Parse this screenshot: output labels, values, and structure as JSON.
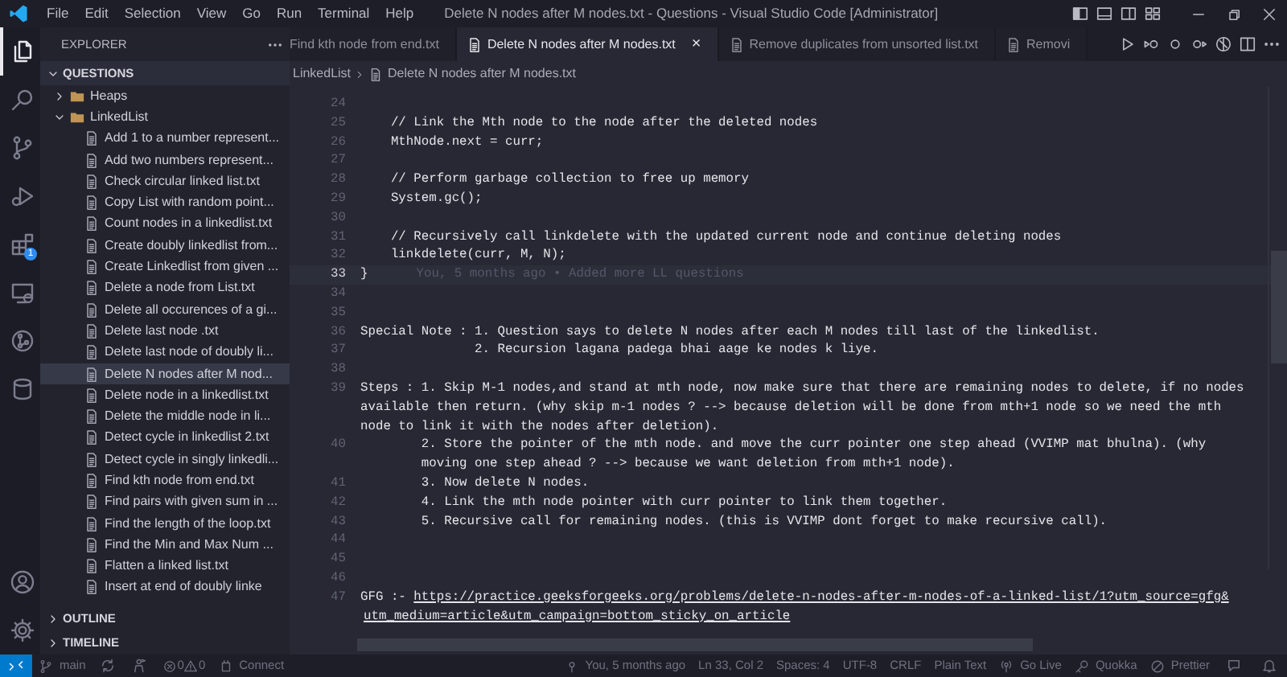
{
  "title_bar": {
    "menu": [
      "File",
      "Edit",
      "Selection",
      "View",
      "Go",
      "Run",
      "Terminal",
      "Help"
    ],
    "title": "Delete N nodes after M nodes.txt - Questions - Visual Studio Code [Administrator]"
  },
  "activity_bar": {
    "top": [
      {
        "kind": "explorer",
        "selected": true
      },
      {
        "kind": "search",
        "selected": false
      },
      {
        "kind": "scm",
        "selected": false
      },
      {
        "kind": "debug",
        "selected": false
      },
      {
        "kind": "extensions",
        "selected": false,
        "badge": "1"
      },
      {
        "kind": "remote",
        "selected": false
      },
      {
        "kind": "graph",
        "selected": false
      },
      {
        "kind": "database",
        "selected": false
      }
    ],
    "bottom": [
      {
        "kind": "account",
        "selected": false
      },
      {
        "kind": "settings",
        "selected": false
      }
    ]
  },
  "sidebar": {
    "title": "EXPLORER",
    "sections": [
      {
        "label": "QUESTIONS",
        "expanded": true,
        "tree": [
          {
            "label": "Heaps",
            "kind": "folder",
            "expanded": false,
            "selected": false
          },
          {
            "label": "LinkedList",
            "kind": "folder",
            "expanded": true,
            "selected": false,
            "children": [
              {
                "label": "Add 1 to a number represent...",
                "kind": "file",
                "selected": false
              },
              {
                "label": "Add two numbers represent...",
                "kind": "file",
                "selected": false
              },
              {
                "label": "Check circular linked list.txt",
                "kind": "file",
                "selected": false
              },
              {
                "label": "Copy List with random point...",
                "kind": "file",
                "selected": false
              },
              {
                "label": "Count nodes in a linkedlist.txt",
                "kind": "file",
                "selected": false
              },
              {
                "label": "Create doubly linkedlist from...",
                "kind": "file",
                "selected": false
              },
              {
                "label": "Create Linkedlist from given ...",
                "kind": "file",
                "selected": false
              },
              {
                "label": "Delete a node from List.txt",
                "kind": "file",
                "selected": false
              },
              {
                "label": "Delete all occurences of a gi...",
                "kind": "file",
                "selected": false
              },
              {
                "label": "Delete last node .txt",
                "kind": "file",
                "selected": false
              },
              {
                "label": "Delete last node of doubly li...",
                "kind": "file",
                "selected": false
              },
              {
                "label": "Delete N nodes after M nod...",
                "kind": "file",
                "selected": true
              },
              {
                "label": "Delete node in a linkedlist.txt",
                "kind": "file",
                "selected": false
              },
              {
                "label": "Delete the middle node in li...",
                "kind": "file",
                "selected": false
              },
              {
                "label": "Detect cycle in linkedlist 2.txt",
                "kind": "file",
                "selected": false
              },
              {
                "label": "Detect cycle in singly linkedli...",
                "kind": "file",
                "selected": false
              },
              {
                "label": "Find kth node from end.txt",
                "kind": "file",
                "selected": false
              },
              {
                "label": "Find pairs with given sum in ...",
                "kind": "file",
                "selected": false
              },
              {
                "label": "Find the length of the loop.txt",
                "kind": "file",
                "selected": false
              },
              {
                "label": "Find the Min and Max Num ...",
                "kind": "file",
                "selected": false
              },
              {
                "label": "Flatten a linked list.txt",
                "kind": "file",
                "selected": false
              },
              {
                "label": "Insert at end of doubly linke",
                "kind": "file",
                "selected": false
              }
            ]
          }
        ]
      },
      {
        "label": "OUTLINE",
        "expanded": false
      },
      {
        "label": "TIMELINE",
        "expanded": false
      }
    ]
  },
  "tabs": [
    {
      "label": "Find kth node from end.txt",
      "selected": false,
      "show_icon": false
    },
    {
      "label": "Delete N nodes after M nodes.txt",
      "selected": true,
      "show_icon": true,
      "close": "×"
    },
    {
      "label": "Remove duplicates from unsorted list.txt",
      "selected": false,
      "show_icon": true
    },
    {
      "label": "Removi",
      "selected": false,
      "show_icon": true
    }
  ],
  "breadcrumb": [
    "LinkedList",
    "Delete N nodes after M nodes.txt"
  ],
  "editor": {
    "lines": [
      {
        "number": "24",
        "current": false
      },
      {
        "number": "25",
        "current": false,
        "rows": [
          "    // Link the Mth node to the node after the deleted nodes"
        ]
      },
      {
        "number": "26",
        "current": false,
        "rows": [
          "    MthNode.next = curr;"
        ]
      },
      {
        "number": "27",
        "current": false
      },
      {
        "number": "28",
        "current": false,
        "rows": [
          "    // Perform garbage collection to free up memory"
        ]
      },
      {
        "number": "29",
        "current": false,
        "rows": [
          "    System.gc();"
        ]
      },
      {
        "number": "30",
        "current": false
      },
      {
        "number": "31",
        "current": false,
        "rows": [
          "    // Recursively call linkdelete with the updated current node and continue deleting nodes"
        ]
      },
      {
        "number": "32",
        "current": false,
        "rows": [
          "    linkdelete(curr, M, N);"
        ]
      },
      {
        "number": "33",
        "current": true,
        "rows": [
          "}"
        ],
        "blame": "You, 5 months ago • Added more LL questions"
      },
      {
        "number": "34",
        "current": false
      },
      {
        "number": "35",
        "current": false
      },
      {
        "number": "36",
        "current": false,
        "rows": [
          "Special Note : 1. Question says to delete N nodes after each M nodes till last of the linkedlist."
        ]
      },
      {
        "number": "37",
        "current": false,
        "rows": [
          "               2. Recursion lagana padega bhai aage ke nodes k liye."
        ]
      },
      {
        "number": "38",
        "current": false
      },
      {
        "number": "39",
        "current": false,
        "rows": [
          "Steps : 1. Skip M-1 nodes,and stand at mth node, now make sure that there are remaining nodes to delete, if no nodes",
          "available then return. (why skip m-1 nodes ? --> because deletion will be done from mth+1 node so we need the mth",
          "node to link it with the nodes after deletion)."
        ]
      },
      {
        "number": "40",
        "current": false,
        "rows": [
          "        2. Store the pointer of the mth node. and move the curr pointer one step ahead (VVIMP mat bhulna). (why",
          "        moving one step ahead ? --> because we want deletion from mth+1 node)."
        ]
      },
      {
        "number": "41",
        "current": false,
        "rows": [
          "        3. Now delete N nodes."
        ]
      },
      {
        "number": "42",
        "current": false,
        "rows": [
          "        4. Link the mth node pointer with curr pointer to link them together."
        ]
      },
      {
        "number": "43",
        "current": false,
        "rows": [
          "        5. Recursive call for remaining nodes. (this is VVIMP dont forget to make recursive call)."
        ]
      },
      {
        "number": "44",
        "current": false
      },
      {
        "number": "45",
        "current": false
      },
      {
        "number": "46",
        "current": false
      },
      {
        "number": "47",
        "current": false,
        "kind": "link",
        "label": "GFG :- ",
        "url": [
          "https://practice.geeksforgeeks.org/problems/delete-n-nodes-after-m-nodes-of-a-linked-list/1?utm_source=gfg&",
          "utm_medium=article&utm_campaign=bottom_sticky_on_article"
        ]
      }
    ]
  },
  "status_bar": {
    "left": [
      {
        "kind": "remote"
      },
      {
        "kind": "branch",
        "text": "main"
      },
      {
        "kind": "sync"
      },
      {
        "kind": "person"
      },
      {
        "kind": "problems",
        "errors": "0",
        "warnings": "0"
      },
      {
        "kind": "connect",
        "text": "Connect"
      }
    ],
    "right": [
      {
        "kind": "blame",
        "text": "You, 5 months ago"
      },
      {
        "kind": "text",
        "text": "Ln 33, Col 2"
      },
      {
        "kind": "text",
        "text": "Spaces: 4"
      },
      {
        "kind": "text",
        "text": "UTF-8"
      },
      {
        "kind": "text",
        "text": "CRLF"
      },
      {
        "kind": "text",
        "text": "Plain Text"
      },
      {
        "kind": "golive",
        "text": "Go Live"
      },
      {
        "kind": "quokka",
        "text": "Quokka"
      },
      {
        "kind": "prettier",
        "text": "Prettier"
      },
      {
        "kind": "feedback"
      },
      {
        "kind": "bell"
      }
    ]
  }
}
